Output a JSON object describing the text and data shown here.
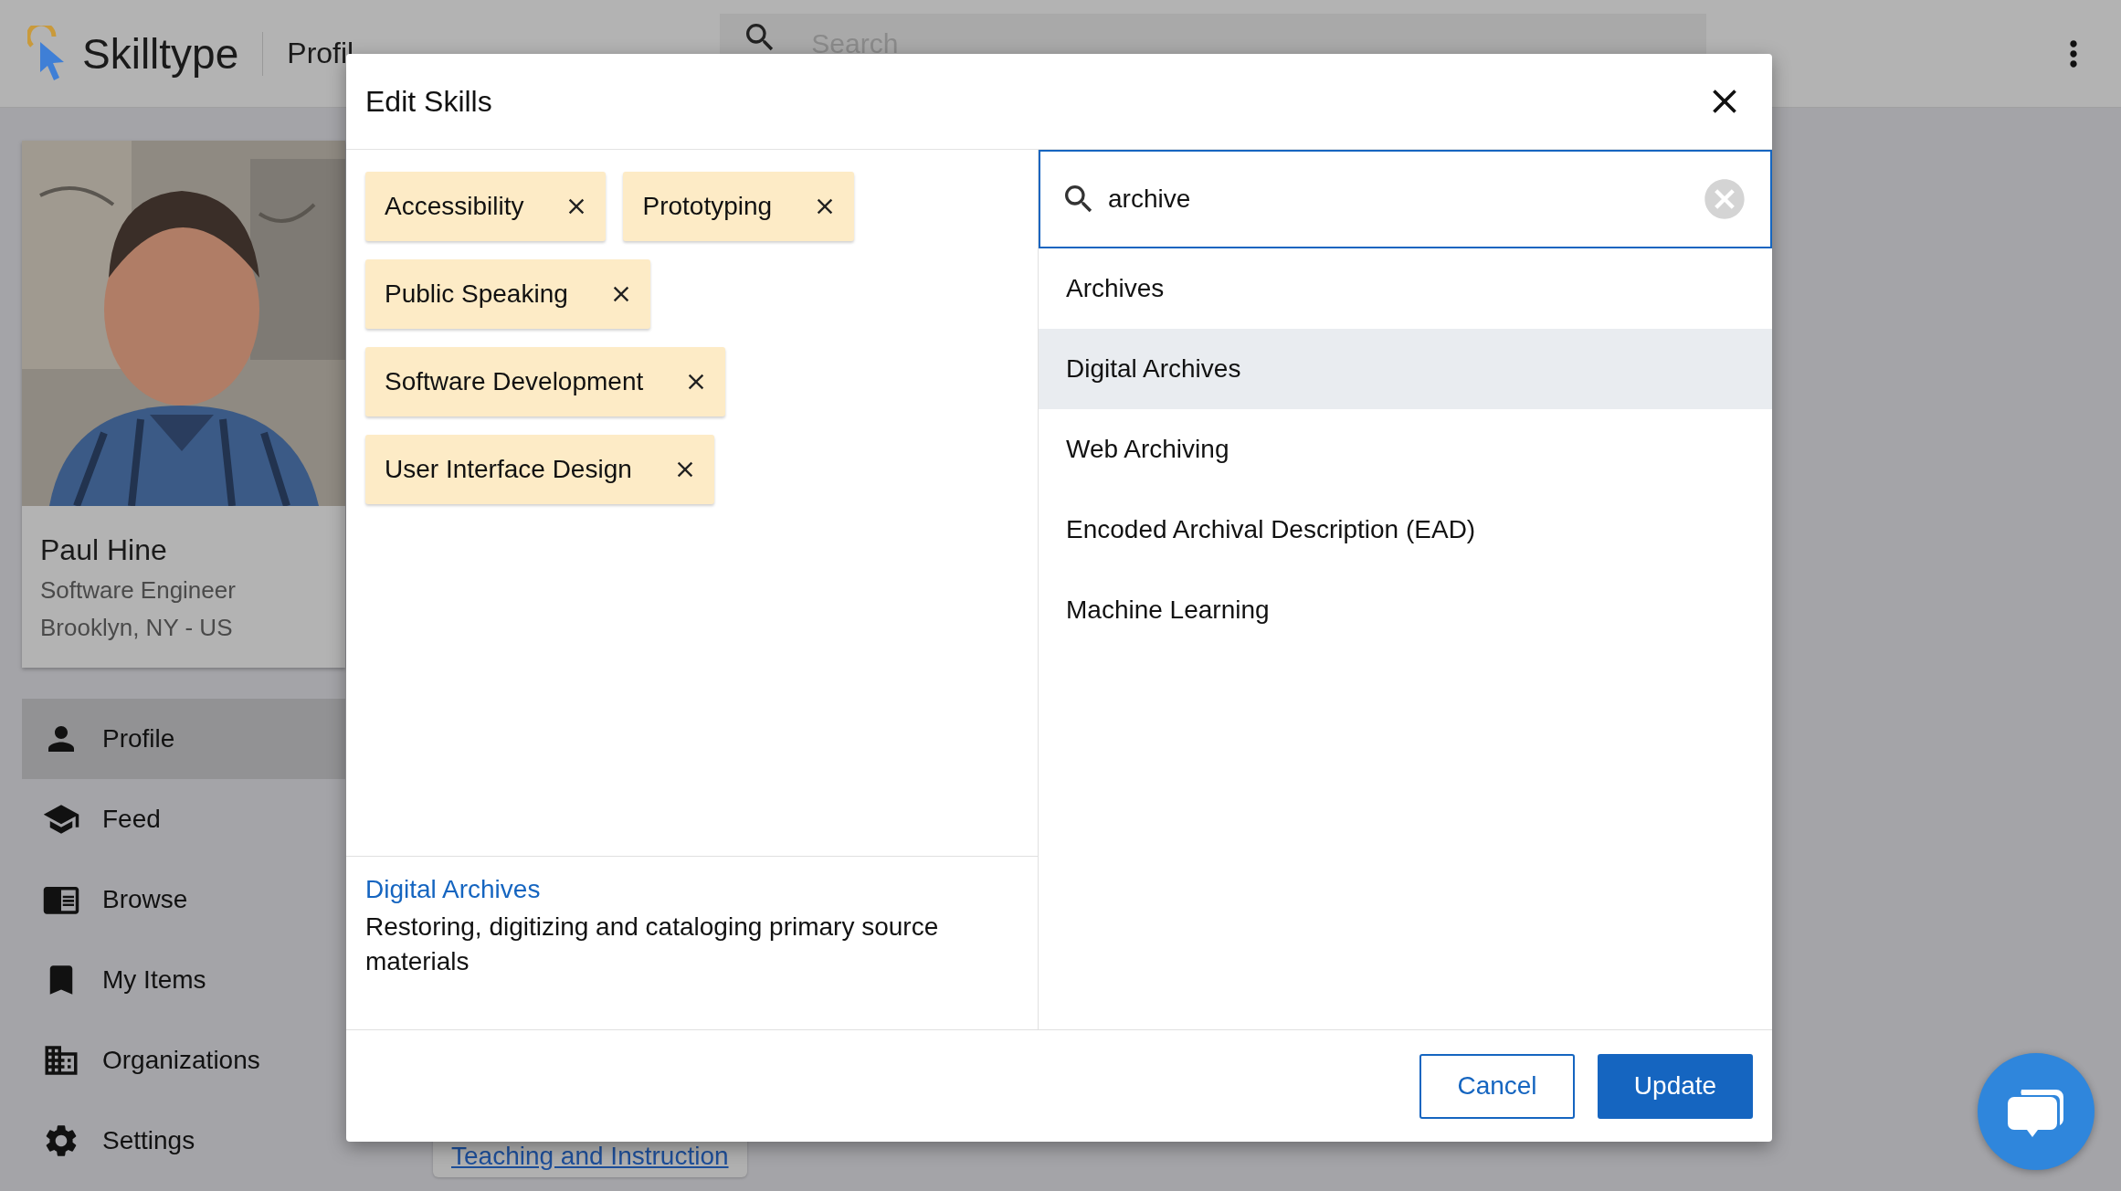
{
  "app_bar": {
    "brand": "Skilltype",
    "page_title": "Profil",
    "search": {
      "placeholder": "Search"
    }
  },
  "profile": {
    "name": "Paul Hine",
    "title": "Software Engineer",
    "location": "Brooklyn, NY - US"
  },
  "sidebar": {
    "items": [
      {
        "label": "Profile",
        "selected": true
      },
      {
        "label": "Feed",
        "selected": false
      },
      {
        "label": "Browse",
        "selected": false
      },
      {
        "label": "My Items",
        "selected": false
      },
      {
        "label": "Organizations",
        "selected": false
      },
      {
        "label": "Settings",
        "selected": false
      }
    ]
  },
  "background_link": "Teaching and Instruction",
  "dialog": {
    "title": "Edit Skills",
    "chips": [
      "Accessibility",
      "Prototyping",
      "Public Speaking",
      "Software Development",
      "User Interface Design"
    ],
    "detail": {
      "title": "Digital Archives",
      "description": "Restoring, digitizing and cataloging primary source materials"
    },
    "search": {
      "value": "archive"
    },
    "results": [
      {
        "label": "Archives",
        "selected": false
      },
      {
        "label": "Digital Archives",
        "selected": true
      },
      {
        "label": "Web Archiving",
        "selected": false
      },
      {
        "label": "Encoded Archival Description (EAD)",
        "selected": false
      },
      {
        "label": "Machine Learning",
        "selected": false
      }
    ],
    "buttons": [
      {
        "label": "Cancel",
        "kind": "secondary"
      },
      {
        "label": "Update",
        "kind": "primary"
      }
    ]
  }
}
